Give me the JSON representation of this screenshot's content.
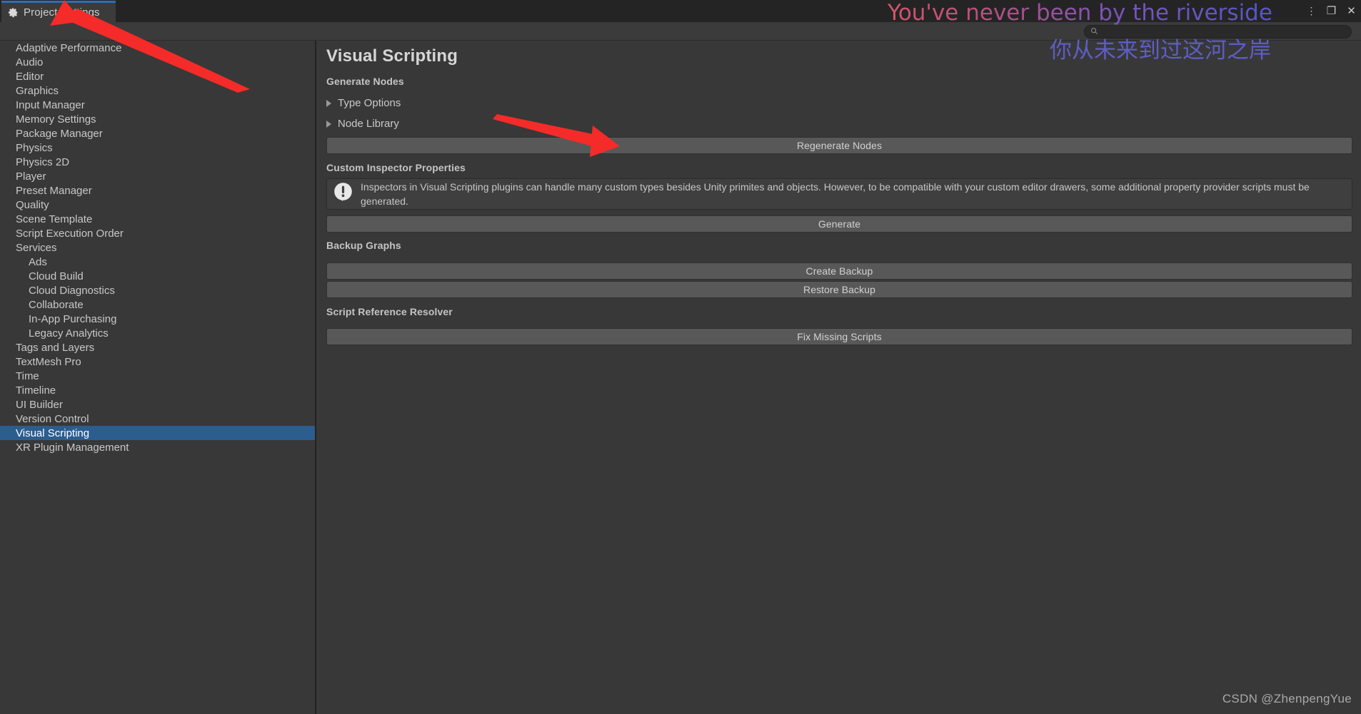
{
  "window": {
    "tab_label": "Project Settings",
    "gear_icon": "gear-icon",
    "controls": {
      "kebab": "⋮",
      "maximize": "❐",
      "close": "✕"
    }
  },
  "search": {
    "placeholder": "",
    "value": "",
    "icon": "search-icon"
  },
  "sidebar": {
    "items": [
      {
        "label": "Adaptive Performance",
        "level": 0,
        "selected": false,
        "expander": "none"
      },
      {
        "label": "Audio",
        "level": 0,
        "selected": false,
        "expander": "none"
      },
      {
        "label": "Editor",
        "level": 0,
        "selected": false,
        "expander": "none"
      },
      {
        "label": "Graphics",
        "level": 0,
        "selected": false,
        "expander": "none"
      },
      {
        "label": "Input Manager",
        "level": 0,
        "selected": false,
        "expander": "none"
      },
      {
        "label": "Memory Settings",
        "level": 0,
        "selected": false,
        "expander": "none"
      },
      {
        "label": "Package Manager",
        "level": 0,
        "selected": false,
        "expander": "none"
      },
      {
        "label": "Physics",
        "level": 0,
        "selected": false,
        "expander": "none"
      },
      {
        "label": "Physics 2D",
        "level": 0,
        "selected": false,
        "expander": "none"
      },
      {
        "label": "Player",
        "level": 0,
        "selected": false,
        "expander": "none"
      },
      {
        "label": "Preset Manager",
        "level": 0,
        "selected": false,
        "expander": "none"
      },
      {
        "label": "Quality",
        "level": 0,
        "selected": false,
        "expander": "none"
      },
      {
        "label": "Scene Template",
        "level": 0,
        "selected": false,
        "expander": "none"
      },
      {
        "label": "Script Execution Order",
        "level": 0,
        "selected": false,
        "expander": "none"
      },
      {
        "label": "Services",
        "level": 0,
        "selected": false,
        "expander": "open"
      },
      {
        "label": "Ads",
        "level": 1,
        "selected": false,
        "expander": "none"
      },
      {
        "label": "Cloud Build",
        "level": 1,
        "selected": false,
        "expander": "none"
      },
      {
        "label": "Cloud Diagnostics",
        "level": 1,
        "selected": false,
        "expander": "none"
      },
      {
        "label": "Collaborate",
        "level": 1,
        "selected": false,
        "expander": "none"
      },
      {
        "label": "In-App Purchasing",
        "level": 1,
        "selected": false,
        "expander": "none"
      },
      {
        "label": "Legacy Analytics",
        "level": 1,
        "selected": false,
        "expander": "none"
      },
      {
        "label": "Tags and Layers",
        "level": 0,
        "selected": false,
        "expander": "none"
      },
      {
        "label": "TextMesh Pro",
        "level": 0,
        "selected": false,
        "expander": "none"
      },
      {
        "label": "Time",
        "level": 0,
        "selected": false,
        "expander": "none"
      },
      {
        "label": "Timeline",
        "level": 0,
        "selected": false,
        "expander": "none"
      },
      {
        "label": "UI Builder",
        "level": 0,
        "selected": false,
        "expander": "none"
      },
      {
        "label": "Version Control",
        "level": 0,
        "selected": false,
        "expander": "none"
      },
      {
        "label": "Visual Scripting",
        "level": 0,
        "selected": true,
        "expander": "none"
      },
      {
        "label": "XR Plugin Management",
        "level": 0,
        "selected": false,
        "expander": "none"
      }
    ]
  },
  "main": {
    "page_title": "Visual Scripting",
    "sections": {
      "generate_nodes": {
        "label": "Generate Nodes",
        "foldouts": [
          {
            "label": "Type Options"
          },
          {
            "label": "Node Library"
          }
        ],
        "button": "Regenerate Nodes"
      },
      "custom_inspector": {
        "label": "Custom Inspector Properties",
        "help_icon": "info-exclamation-icon",
        "help_text": "Inspectors in Visual Scripting plugins can handle many custom types besides Unity primites and objects. However, to be compatible with your custom editor drawers, some additional property provider scripts must be generated.",
        "button": "Generate"
      },
      "backup_graphs": {
        "label": "Backup Graphs",
        "buttons": [
          "Create Backup",
          "Restore Backup"
        ]
      },
      "script_reference_resolver": {
        "label": "Script Reference Resolver",
        "button": "Fix Missing Scripts"
      }
    }
  },
  "overlay": {
    "english": "You've never been by the riverside",
    "chinese": "你从未来到过这河之岸"
  },
  "watermark": "CSDN @ZhenpengYue",
  "colors": {
    "background": "#383838",
    "titlebar": "#242424",
    "tab_accent": "#2f6eb5",
    "selection": "#2c5d8f",
    "button": "#585858",
    "helpbox": "#3f3f3f",
    "text": "#c8c8c8",
    "arrow_red": "#f42b28",
    "overlay_start": "#d4546a",
    "overlay_end": "#5656c4"
  }
}
